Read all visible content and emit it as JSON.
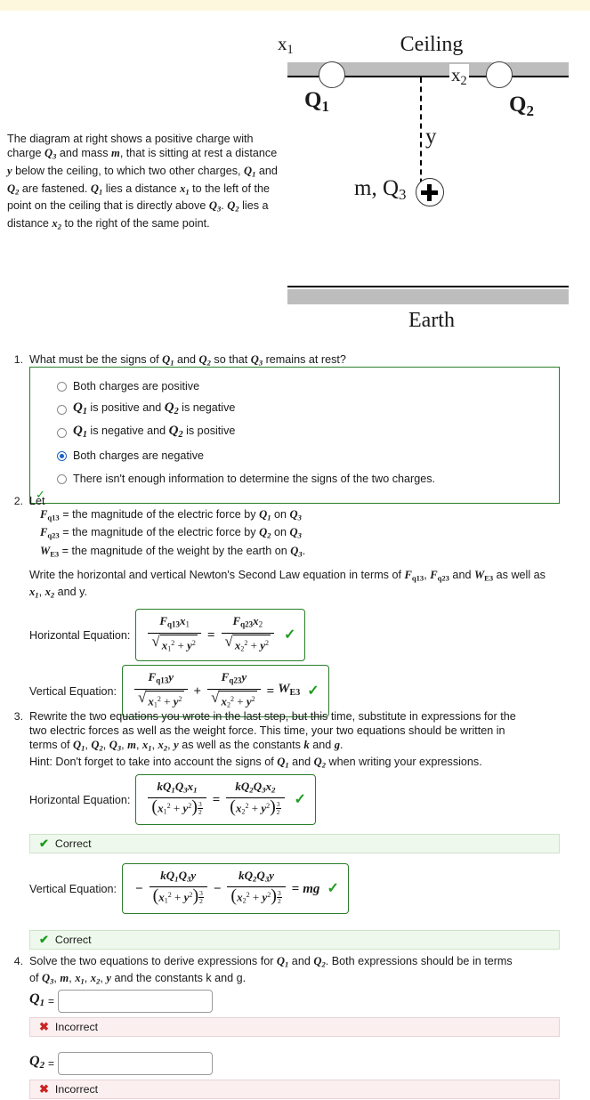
{
  "diagram": {
    "ceiling_label": "Ceiling",
    "earth_label": "Earth",
    "charge_left_label": "Q",
    "charge_left_sub": "1",
    "charge_right_label": "Q",
    "charge_right_sub": "2",
    "dist_left_label": "x",
    "dist_left_sub": "1",
    "dist_right_label": "x",
    "dist_right_sub": "2",
    "vertical_label": "y",
    "mass_charge_label": "m, Q",
    "mass_charge_sub": "3",
    "plus_sign": "+"
  },
  "intro": {
    "text_part1": "The diagram at right shows a positive charge with charge ",
    "q3": "Q",
    "q3sub": "3",
    "text_part2": " and mass ",
    "m": "m",
    "text_part3": ", that is sitting at rest a distance ",
    "y": "y",
    "text_part4": " below the ceiling, to which two other charges, ",
    "q1": "Q",
    "q1sub": "1",
    "text_part5": " and ",
    "q2": "Q",
    "q2sub": "2",
    "text_part6": " are fastened. ",
    "text_part7": " lies a distance ",
    "x1": "x",
    "x1sub": "1",
    "text_part8": " to the left of the point on the ceiling that is directly above ",
    "text_part9": ". ",
    "text_part10": " lies a distance ",
    "x2": "x",
    "x2sub": "2",
    "text_part11": " to the right of the same point."
  },
  "questions": [
    {
      "number": "1.",
      "prompt_a": "What must be the signs of ",
      "prompt_b": " and ",
      "prompt_c": " so that ",
      "prompt_d": " remains at rest?",
      "options": [
        {
          "label": "Both charges are positive",
          "selected": false,
          "type": "plain"
        },
        {
          "label_pre": " is positive and ",
          "label_post": " is negative",
          "selected": false,
          "type": "math"
        },
        {
          "label_pre": " is negative and ",
          "label_post": " is positive",
          "selected": false,
          "type": "math"
        },
        {
          "label": "Both charges are negative",
          "selected": true,
          "type": "plain"
        },
        {
          "label": "There isn't enough information to determine the signs of the two charges.",
          "selected": false,
          "type": "plain"
        }
      ],
      "check_mark": "✓"
    },
    {
      "number": "2.",
      "lead": "Let",
      "definitions": [
        {
          "sym": "F",
          "sub": "q13",
          "text": " = the magnitude of the electric force by ",
          "by": "Q",
          "bysub": "1",
          "on": " on ",
          "target": "Q",
          "targetsub": "3",
          "end": ""
        },
        {
          "sym": "F",
          "sub": "q23",
          "text": " = the magnitude of the electric force by ",
          "by": "Q",
          "bysub": "2",
          "on": " on ",
          "target": "Q",
          "targetsub": "3",
          "end": ""
        },
        {
          "sym": "W",
          "sub": "E3",
          "text": " = the magnitude of the weight by the earth on ",
          "by": "",
          "bysub": "",
          "on": "",
          "target": "Q",
          "targetsub": "3",
          "end": "."
        }
      ],
      "instruction_a": "Write the horizontal and vertical Newton's Second Law equation in terms of ",
      "instruction_b": ", ",
      "instruction_c": " and ",
      "instruction_d": " as well as ",
      "instruction_e": ", ",
      "instruction_f": " and y.",
      "horizontal_label": "Horizontal Equation:",
      "vertical_label": "Vertical Equation:",
      "horizontal_answer": "F_q13*x1 / sqrt(x1^2+y^2) = F_q23*x2 / sqrt(x2^2+y^2)",
      "vertical_answer": "F_q13*y / sqrt(x1^2+y^2) + F_q23*y / sqrt(x2^2+y^2) = W_E3",
      "horizontal_status": "correct",
      "vertical_status": "correct"
    },
    {
      "number": "3.",
      "prompt_line1": "Rewrite the two equations you wrote in the last step, but this time, substitute in expressions for the",
      "prompt_line2": "two electric forces as well as the weight force. This time, your two equations should be written in",
      "prompt_line3_pre": "terms of ",
      "prompt_line3_post": " as well as the constants ",
      "k": "k",
      "and": " and ",
      "g": "g",
      "period": ".",
      "hint_pre": "Hint: Don't forget to take into account the signs of ",
      "hint_mid": " and ",
      "hint_post": " when writing your expressions.",
      "horizontal_label": "Horizontal Equation:",
      "vertical_label": "Vertical Equation:",
      "horizontal_answer": "kQ1Q3x1/(x1^2+y^2)^(3/2) = kQ2Q3x2/(x2^2+y^2)^(3/2)",
      "vertical_answer": "-kQ1Q3y/(x1^2+y^2)^(3/2) - kQ2Q3y/(x2^2+y^2)^(3/2) = mg",
      "horizontal_banner": "Correct",
      "vertical_banner": "Correct"
    },
    {
      "number": "4.",
      "prompt_line1_a": "Solve the two equations to derive expressions for ",
      "prompt_line1_b": " and ",
      "prompt_line1_c": ". Both expressions should be in terms",
      "prompt_line2_pre": "of ",
      "prompt_line2_post": " and the constants k and g.",
      "answer1_label": "Q",
      "answer1_sub": "1",
      "answer1_value": "",
      "answer1_placeholder": "",
      "answer1_banner": "Incorrect",
      "answer2_label": "Q",
      "answer2_sub": "2",
      "answer2_value": "",
      "answer2_placeholder": "",
      "answer2_banner": "Incorrect"
    }
  ],
  "icons": {
    "correct": "✔",
    "incorrect": "✖",
    "small_check": "✓"
  },
  "colors": {
    "correct_green": "#1f9c1f",
    "incorrect_red": "#cc2222",
    "box_border_green": "#2a7d2a",
    "radio_blue": "#1a62c4",
    "top_band": "#fdf8dd"
  }
}
